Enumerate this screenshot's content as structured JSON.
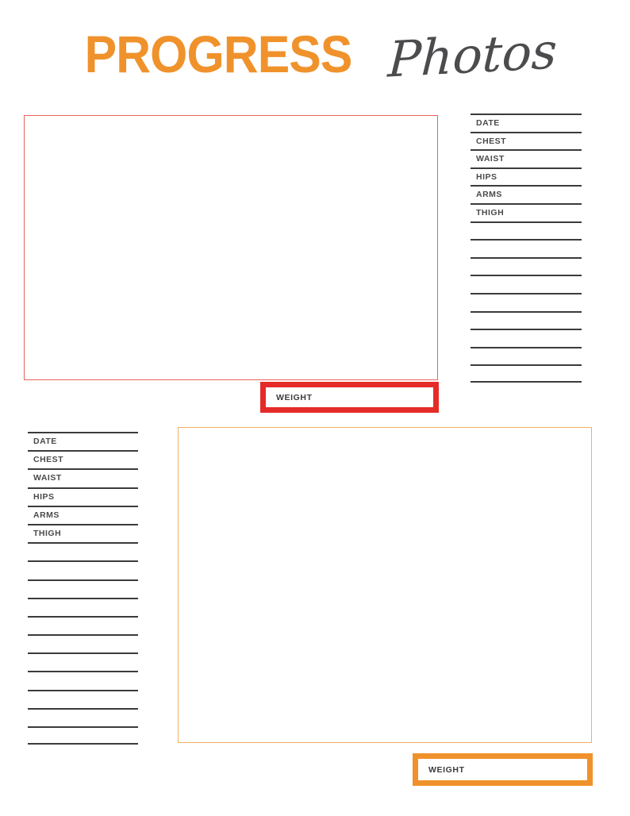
{
  "page": {
    "title_primary": "PROGRESS",
    "title_script": "Photos",
    "colors": {
      "orange": "#F0922B",
      "red": "#E52B28",
      "red_frame": "#E8645B",
      "orange_frame": "#EFB160",
      "text_dark": "#4a4a4a",
      "rule": "#3b3b3b"
    }
  },
  "top_section": {
    "photo_frame": {
      "name": "photo-placeholder-top"
    },
    "weight_label": "WEIGHT",
    "measurements": {
      "labels": [
        "DATE",
        "CHEST",
        "WAIST",
        "HIPS",
        "ARMS",
        "THIGH"
      ],
      "blank_line_count": 9
    }
  },
  "bottom_section": {
    "photo_frame": {
      "name": "photo-placeholder-bottom"
    },
    "weight_label": "WEIGHT",
    "measurements": {
      "labels": [
        "DATE",
        "CHEST",
        "WAIST",
        "HIPS",
        "ARMS",
        "THIGH"
      ],
      "blank_line_count": 11
    }
  }
}
